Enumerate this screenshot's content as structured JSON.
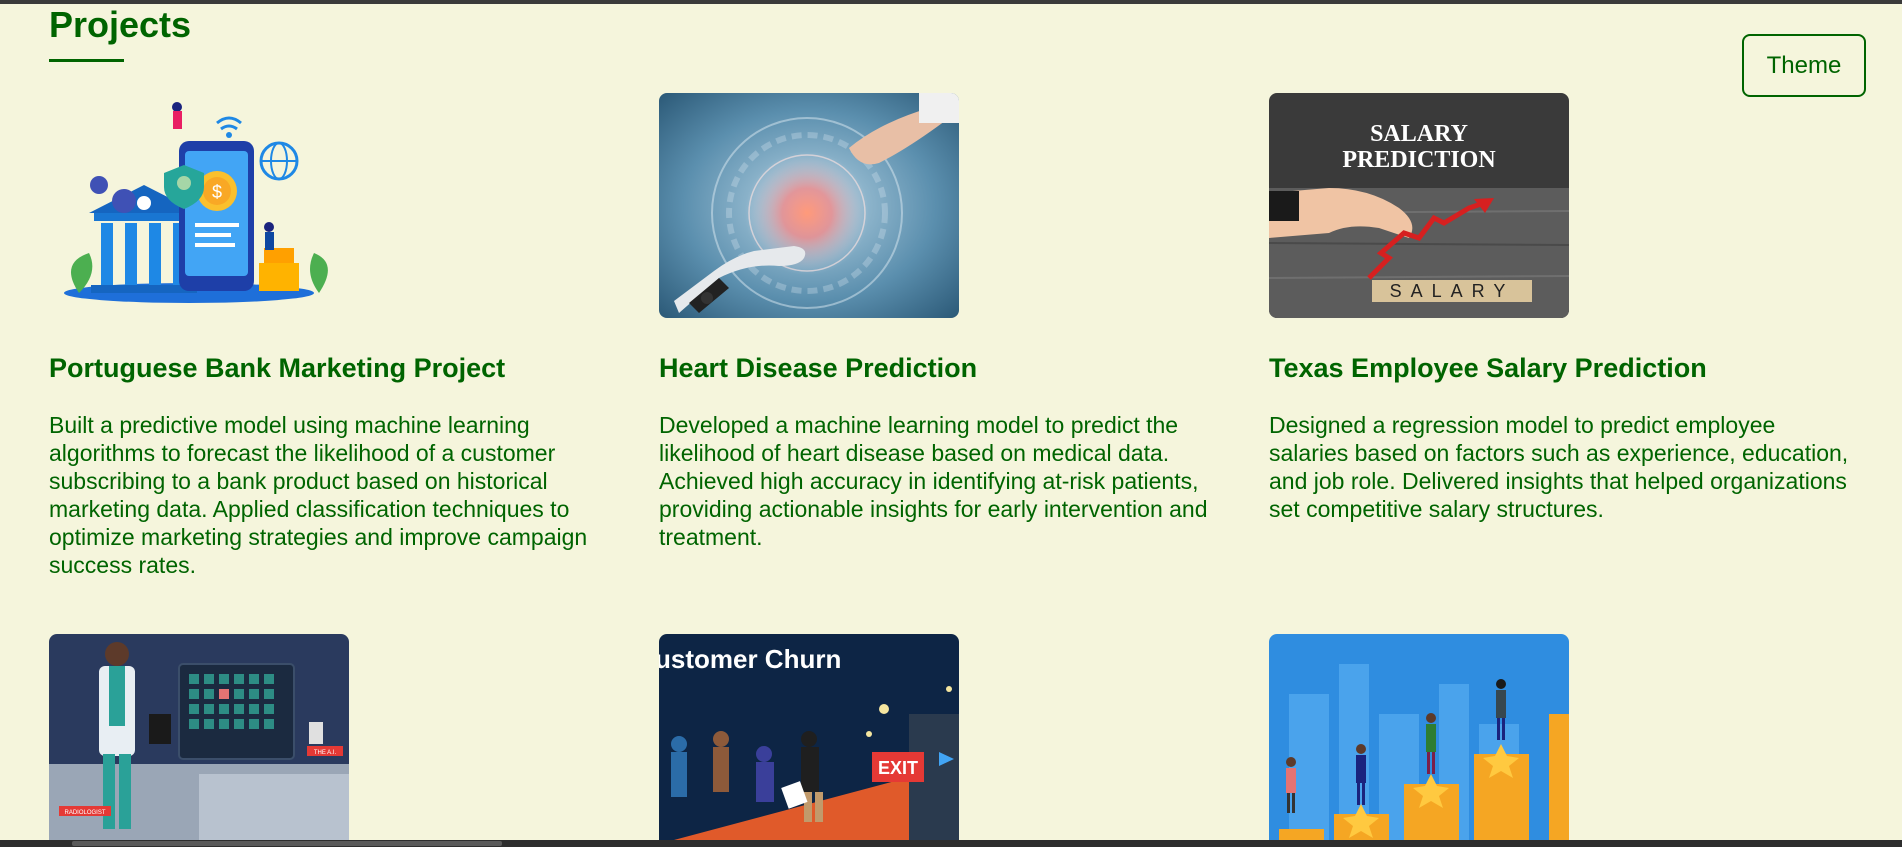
{
  "section": {
    "title": "Projects"
  },
  "theme_button": {
    "label": "Theme"
  },
  "projects": [
    {
      "title": "Portuguese Bank Marketing Project",
      "description": "Built a predictive model using machine learning algorithms to forecast the likelihood of a customer subscribing to a bank product based on historical marketing data. Applied classification techniques to optimize marketing strategies and improve campaign success rates."
    },
    {
      "title": "Heart Disease Prediction",
      "description": "Developed a machine learning model to predict the likelihood of heart disease based on medical data. Achieved high accuracy in identifying at-risk patients, providing actionable insights for early intervention and treatment."
    },
    {
      "title": "Texas Employee Salary Prediction",
      "description": "Designed a regression model to predict employee salaries based on factors such as experience, education, and job role. Delivered insights that helped organizations set competitive salary structures."
    }
  ],
  "image_text": {
    "salary_line1": "SALARY",
    "salary_line2": "PREDICTION",
    "salary_blocks": "SALARY",
    "churn_title": "ustomer Churn",
    "exit_sign": "EXIT",
    "radiology_sign": "RADIOLOGIST",
    "ai_sign": "THE A.I."
  },
  "colors": {
    "accent": "#006400",
    "background": "#f5f5dc"
  }
}
